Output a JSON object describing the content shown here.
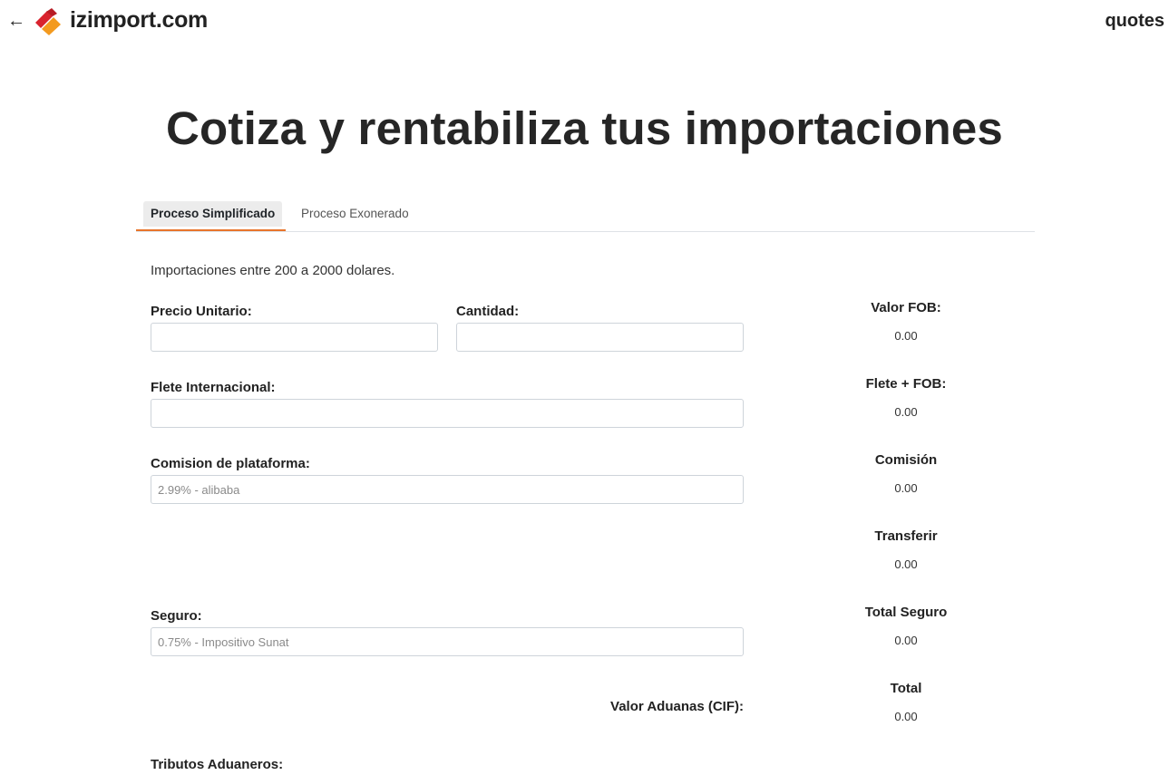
{
  "header": {
    "back_icon": "arrow-left-icon",
    "logo_icon": "izimport-logo-icon",
    "brand": "izimport.com",
    "nav_link": "quotes",
    "colors": {
      "logo_red": "#d9232e",
      "logo_orange": "#f39a1f"
    }
  },
  "page": {
    "title": "Cotiza y rentabiliza tus importaciones",
    "tabs": [
      {
        "label": "Proceso Simplificado",
        "active": true
      },
      {
        "label": "Proceso Exonerado",
        "active": false
      }
    ],
    "accent_color": "#e8742b"
  },
  "form": {
    "intro": "Importaciones entre 200 a 2000 dolares.",
    "precio_unitario": {
      "label": "Precio Unitario:",
      "value": "",
      "placeholder": ""
    },
    "cantidad": {
      "label": "Cantidad:",
      "value": "",
      "placeholder": ""
    },
    "flete_internacional": {
      "label": "Flete Internacional:",
      "value": "",
      "placeholder": ""
    },
    "comision_plataforma": {
      "label": "Comision de plataforma:",
      "value": "",
      "placeholder": "2.99% - alibaba"
    },
    "seguro": {
      "label": "Seguro:",
      "value": "",
      "placeholder": "0.75% - Impositivo Sunat"
    },
    "valor_aduanas": {
      "label": "Valor Aduanas (CIF):"
    },
    "tributos_aduaneros": {
      "label": "Tributos Aduaneros:"
    }
  },
  "results": [
    {
      "label": "Valor FOB:",
      "value": "0.00"
    },
    {
      "label": "Flete + FOB:",
      "value": "0.00"
    },
    {
      "label": "Comisión",
      "value": "0.00"
    },
    {
      "label": "Transferir",
      "value": "0.00"
    },
    {
      "label": "Total Seguro",
      "value": "0.00"
    },
    {
      "label": "Total",
      "value": "0.00"
    }
  ]
}
